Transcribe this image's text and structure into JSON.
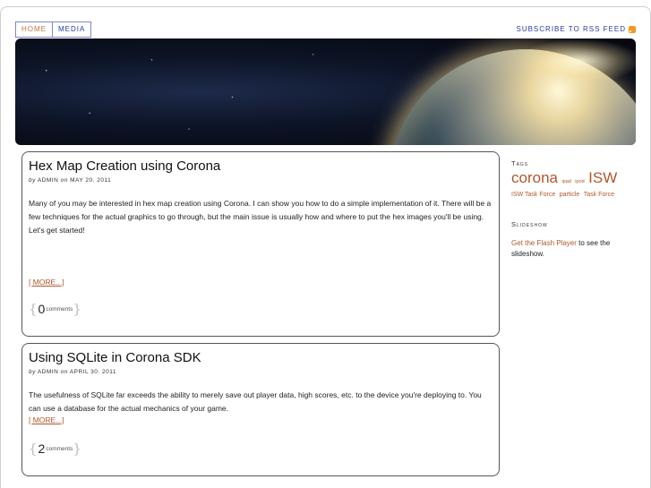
{
  "nav": {
    "home_label": "Home",
    "media_label": "Media"
  },
  "rss": {
    "label": "Subscribe to RSS Feed",
    "icon": "rss-icon"
  },
  "posts": [
    {
      "title": "Hex Map Creation using Corona",
      "by": "by",
      "author": "ADMIN",
      "on": "on",
      "date": "MAY 20. 2011",
      "body": "Many of you may be interested in hex map creation using Corona. I can show you how to do a simple implementation of it. There will be a few techniques for the actual graphics to go through, but the main issue is usually how and where to put the hex images you'll be using. Let's get started!",
      "more": "[ MORE...]",
      "comment_count": "0",
      "comment_label": "comments"
    },
    {
      "title": "Using SQLite in Corona SDK",
      "by": "by",
      "author": "ADMIN",
      "on": "on",
      "date": "APRIL 30. 2011",
      "body": "The usefulness of SQLite far exceeds the ability to merely save out player data, high scores, etc. to the device you're deploying to. You can use a database for the actual mechanics of your game.",
      "more": "[ MORE...]",
      "comment_count": "2",
      "comment_label": "comments"
    }
  ],
  "sidebar": {
    "tags_heading": "Tags",
    "tags": [
      "corona",
      "ipad",
      "ipod",
      "ISW",
      "ISW Task Force",
      "particle",
      "Task Force"
    ],
    "slideshow_heading": "Slideshow",
    "flash_link": "Get the Flash Player",
    "slideshow_rest": " to see the slideshow."
  },
  "colors": {
    "link": "#b0572c",
    "nav_blue": "#2b3aa8",
    "active_tab": "#c0743e"
  }
}
